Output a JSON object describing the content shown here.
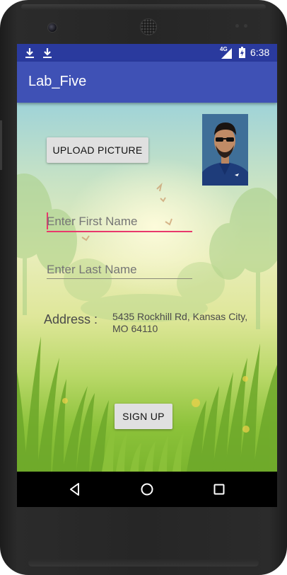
{
  "status_bar": {
    "time": "6:38",
    "network": "4G",
    "notification_icons": [
      "download-icon",
      "download-icon"
    ],
    "status_icons": [
      "signal-icon",
      "battery-icon"
    ]
  },
  "app_bar": {
    "title": "Lab_Five"
  },
  "form": {
    "upload_button_label": "UPLOAD PICTURE",
    "first_name_placeholder": "Enter First Name",
    "first_name_value": "",
    "last_name_placeholder": "Enter Last Name",
    "last_name_value": "",
    "address_label": "Address :",
    "address_value": "5435 Rockhill Rd, Kansas City, MO 64110",
    "signup_button_label": "SIGN UP",
    "profile_image": "profile-photo"
  },
  "nav_bar": {
    "buttons": [
      "back-icon",
      "home-icon",
      "recents-icon"
    ]
  },
  "colors": {
    "status_bar": "#2a3a9e",
    "app_bar": "#3f51b5",
    "accent": "#e8386c",
    "button": "#e0e0e0"
  }
}
